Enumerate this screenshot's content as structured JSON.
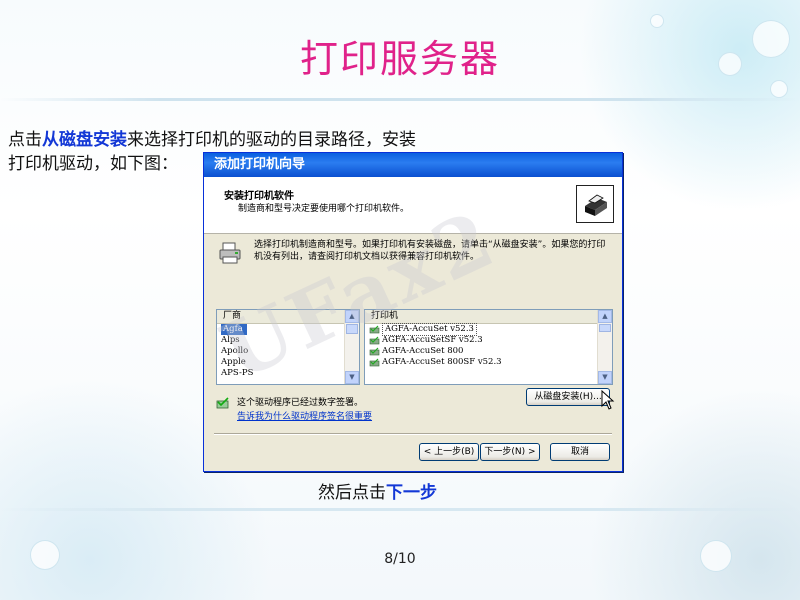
{
  "slide": {
    "title": "打印服务器",
    "intro_line1_pre": "点击",
    "intro_line1_hl": "从磁盘安装",
    "intro_line1_post": "来选择打印机的驱动的目录路径，安装",
    "intro_line2": "打印机驱动，如下图：",
    "caption_pre": "然后点击",
    "caption_hl": "下一步",
    "page": "8/10"
  },
  "dialog": {
    "title": "添加打印机向导",
    "header_title": "安装打印机软件",
    "header_subtitle": "制造商和型号决定要使用哪个打印机软件。",
    "instruction": "选择打印机制造商和型号。如果打印机有安装磁盘，请单击“从磁盘安装”。如果您的打印机没有列出，请查阅打印机文档以获得兼容打印机软件。",
    "manufacturer_header": "厂商",
    "manufacturers": [
      "Agfa",
      "Alps",
      "Apollo",
      "Apple",
      "APS-PS"
    ],
    "printer_header": "打印机",
    "printers": [
      "AGFA-AccuSet v52.3",
      "AGFA-AccuSetSF v52.3",
      "AGFA-AccuSet 800",
      "AGFA-AccuSet 800SF v52.3"
    ],
    "have_disk_label": "从磁盘安装(H)...",
    "signed_text": "这个驱动程序已经过数字签署。",
    "signing_link": "告诉我为什么驱动程序签名很重要",
    "back_label": "< 上一步(B)",
    "next_label": "下一步(N) >",
    "cancel_label": "取消"
  },
  "watermark": "UFax2",
  "colors": {
    "title": "#e0228a",
    "highlight": "#1338d6",
    "xp_title_bar": "#0a5fe0",
    "xp_face": "#ece9d8",
    "selection": "#316ac5"
  }
}
